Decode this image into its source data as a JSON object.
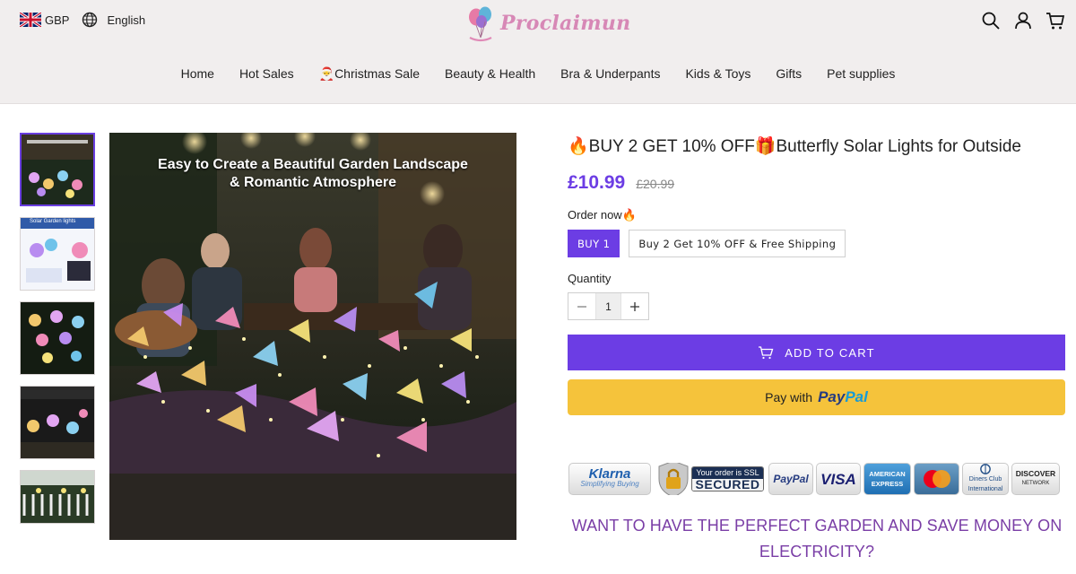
{
  "header": {
    "currency": "GBP",
    "language": "English",
    "logo_text": "Proclaimun",
    "icons": [
      "search-icon",
      "account-icon",
      "cart-icon"
    ]
  },
  "nav": {
    "items": [
      {
        "label": "Home"
      },
      {
        "label": "Hot Sales"
      },
      {
        "label": "🎅Christmas Sale"
      },
      {
        "label": "Beauty & Health"
      },
      {
        "label": "Bra & Underpants"
      },
      {
        "label": "Kids & Toys"
      },
      {
        "label": "Gifts"
      },
      {
        "label": "Pet supplies"
      }
    ]
  },
  "gallery": {
    "main_caption_line1": "Easy to Create a Beautiful Garden Landscape",
    "main_caption_line2": "& Romantic Atmosphere",
    "thumb_2_caption": "Solar Garden lights"
  },
  "product": {
    "title": "🔥BUY 2 GET 10% OFF🎁Butterfly Solar Lights for Outside",
    "price": "£10.99",
    "compare_price": "£20.99",
    "order_label": "Order now🔥",
    "variants": [
      {
        "label": "BUY 1",
        "selected": true
      },
      {
        "label": "Buy 2 Get 10% OFF & Free Shipping",
        "selected": false
      }
    ],
    "quantity_label": "Quantity",
    "quantity_value": "1",
    "add_to_cart": "ADD TO CART",
    "paypal_prefix": "Pay with",
    "paypal_pay": "Pay",
    "paypal_pal": "Pal"
  },
  "badges": {
    "klarna": "Klarna",
    "klarna_tag": "Simplifying Buying",
    "ssl_top": "Your order is SSL",
    "ssl_bottom": "SECURED",
    "paypal": "PayPal",
    "visa": "VISA",
    "amex": "AMERICAN EXPRESS",
    "diners": "Diners Club International",
    "discover": "DISCOVER",
    "discover_tag": "NETWORK"
  },
  "promo": {
    "text": "WANT TO HAVE THE PERFECT GARDEN AND SAVE MONEY ON ELECTRICITY?"
  },
  "colors": {
    "accent": "#6c3de4",
    "paypal_button": "#f5c33b",
    "header_bg": "#f1eeee",
    "promo_text": "#7a3ea6",
    "logo": "#d788b6"
  }
}
